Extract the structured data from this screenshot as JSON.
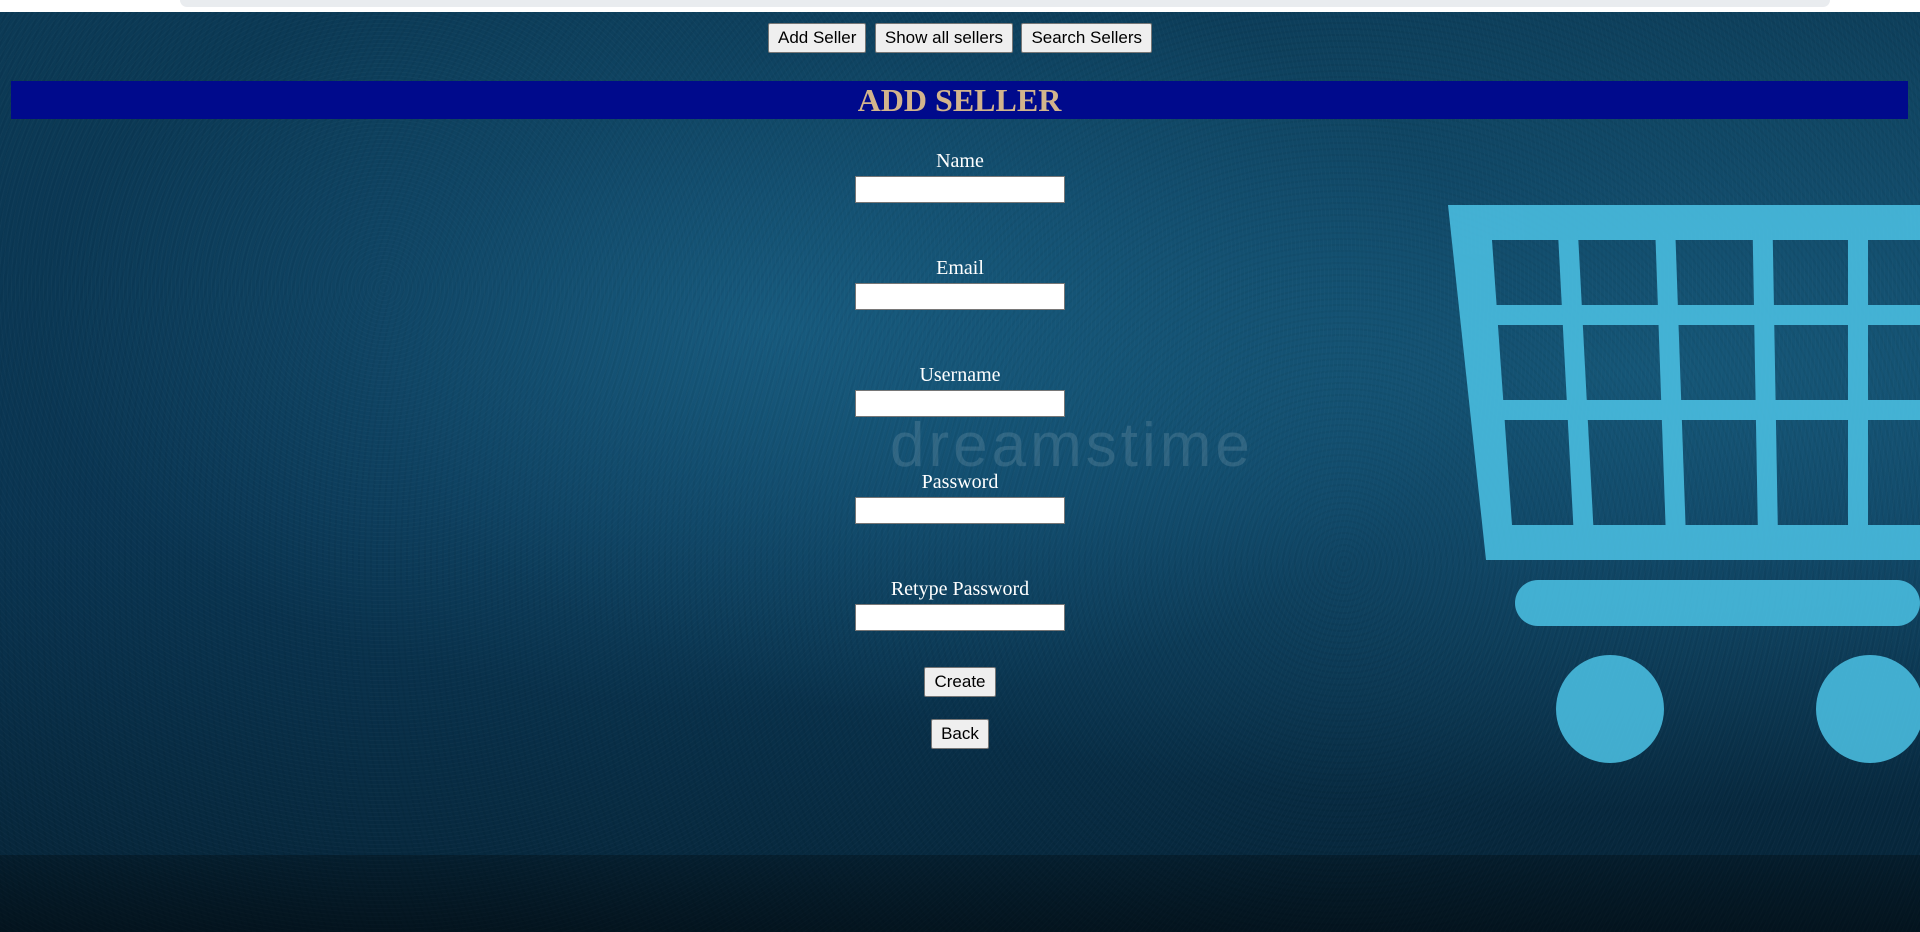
{
  "nav": {
    "add_seller": "Add Seller",
    "show_all_sellers": "Show all sellers",
    "search_sellers": "Search Sellers"
  },
  "page": {
    "heading": "ADD SELLER"
  },
  "form": {
    "name_label": "Name",
    "name_value": "",
    "email_label": "Email",
    "email_value": "",
    "username_label": "Username",
    "username_value": "",
    "password_label": "Password",
    "password_value": "",
    "retype_password_label": "Retype Password",
    "retype_password_value": "",
    "create_label": "Create",
    "back_label": "Back"
  },
  "background": {
    "watermark": "dreamstime",
    "icon": "shopping-cart-icon"
  },
  "colors": {
    "banner": "#000a8c",
    "heading": "#d2b48c",
    "cart": "#4cc3e6"
  }
}
